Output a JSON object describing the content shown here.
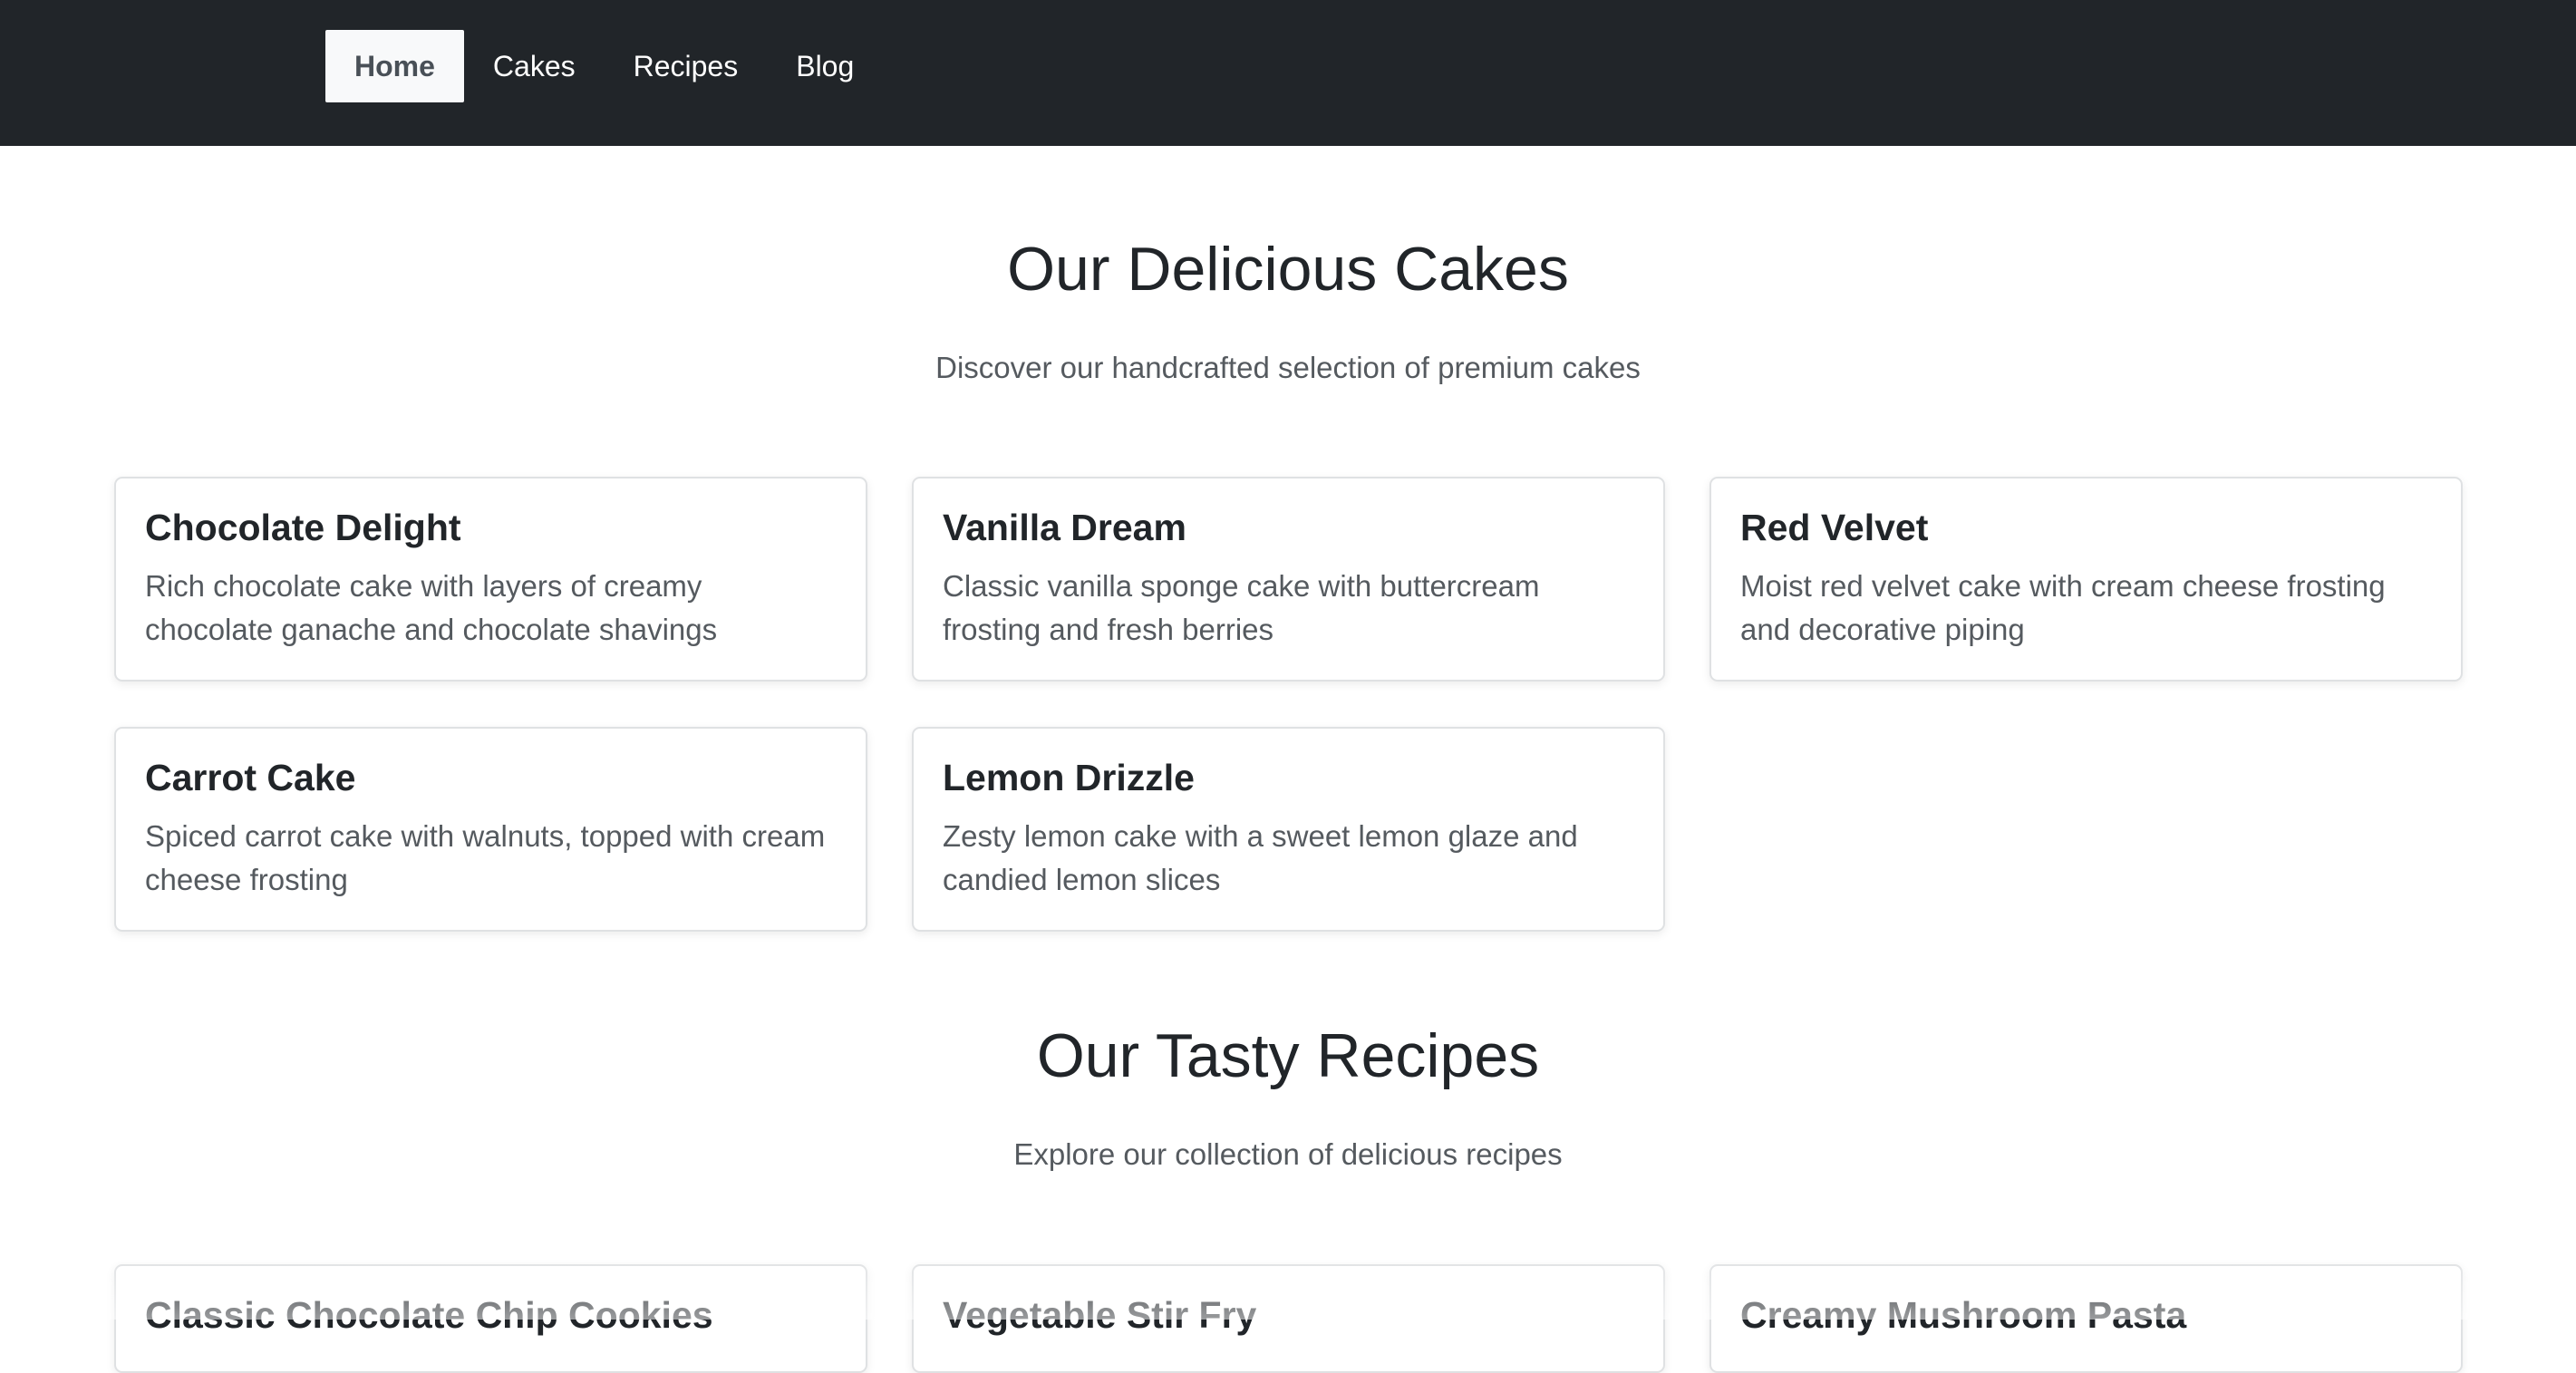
{
  "nav": {
    "items": [
      {
        "label": "Home",
        "active": true
      },
      {
        "label": "Cakes",
        "active": false
      },
      {
        "label": "Recipes",
        "active": false
      },
      {
        "label": "Blog",
        "active": false
      }
    ]
  },
  "cakes": {
    "title": "Our Delicious Cakes",
    "subtitle": "Discover our handcrafted selection of premium cakes",
    "cards": [
      {
        "title": "Chocolate Delight",
        "text": "Rich chocolate cake with layers of creamy chocolate ganache and chocolate shavings"
      },
      {
        "title": "Vanilla Dream",
        "text": "Classic vanilla sponge cake with buttercream frosting and fresh berries"
      },
      {
        "title": "Red Velvet",
        "text": "Moist red velvet cake with cream cheese frosting and decorative piping"
      },
      {
        "title": "Carrot Cake",
        "text": "Spiced carrot cake with walnuts, topped with cream cheese frosting"
      },
      {
        "title": "Lemon Drizzle",
        "text": "Zesty lemon cake with a sweet lemon glaze and candied lemon slices"
      }
    ]
  },
  "recipes": {
    "title": "Our Tasty Recipes",
    "subtitle": "Explore our collection of delicious recipes",
    "cards": [
      {
        "title": "Classic Chocolate Chip Cookies"
      },
      {
        "title": "Vegetable Stir Fry"
      },
      {
        "title": "Creamy Mushroom Pasta"
      }
    ]
  },
  "colors": {
    "navbar_bg": "#212529",
    "active_nav_bg": "#f8f9fa",
    "text_dark": "#212529",
    "text_muted": "#555a5f",
    "card_border": "#dfe1e3"
  }
}
